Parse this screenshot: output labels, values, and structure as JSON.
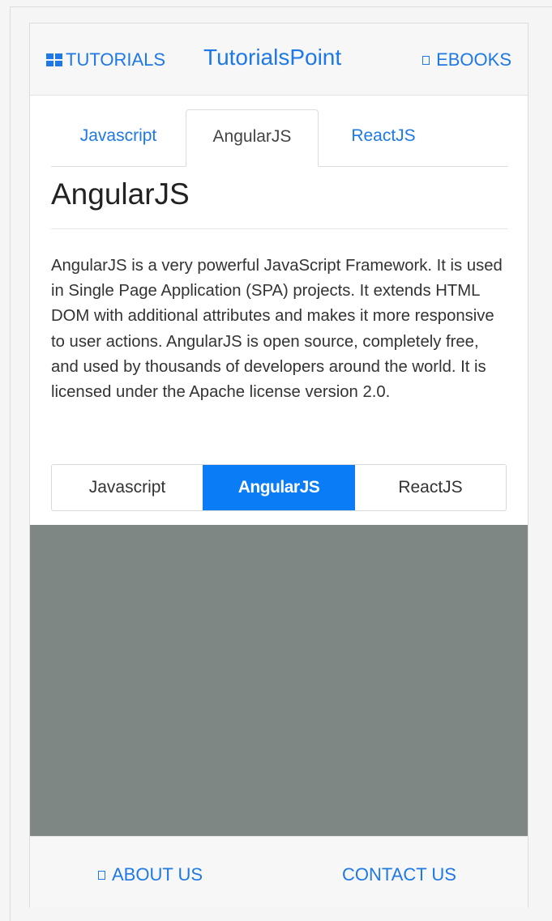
{
  "header": {
    "tutorials_label": "TUTORIALS",
    "title": "TutorialsPoint",
    "ebooks_label": "EBOOKS"
  },
  "tabs": [
    {
      "label": "Javascript",
      "active": false
    },
    {
      "label": "AngularJS",
      "active": true
    },
    {
      "label": "ReactJS",
      "active": false
    }
  ],
  "content": {
    "title": "AngularJS",
    "text": "AngularJS is a very powerful JavaScript Framework. It is used in Single Page Application (SPA) projects. It extends HTML DOM with additional attributes and makes it more responsive to user actions. AngularJS is open source, completely free, and used by thousands of developers around the world. It is licensed under the Apache license version 2.0."
  },
  "segmented": [
    {
      "label": "Javascript",
      "active": false
    },
    {
      "label": "AngularJS",
      "active": true
    },
    {
      "label": "ReactJS",
      "active": false
    }
  ],
  "footer": {
    "about_label": "ABOUT US",
    "contact_label": "CONTACT US"
  },
  "colors": {
    "accent": "#1e78e6",
    "segment_active": "#0a7cf5",
    "gray_area": "#7f8784",
    "header_bg": "#f7f7f7"
  },
  "icons": {
    "tutorials": "grid-icon",
    "ebooks": "book-icon",
    "about": "info-icon"
  }
}
